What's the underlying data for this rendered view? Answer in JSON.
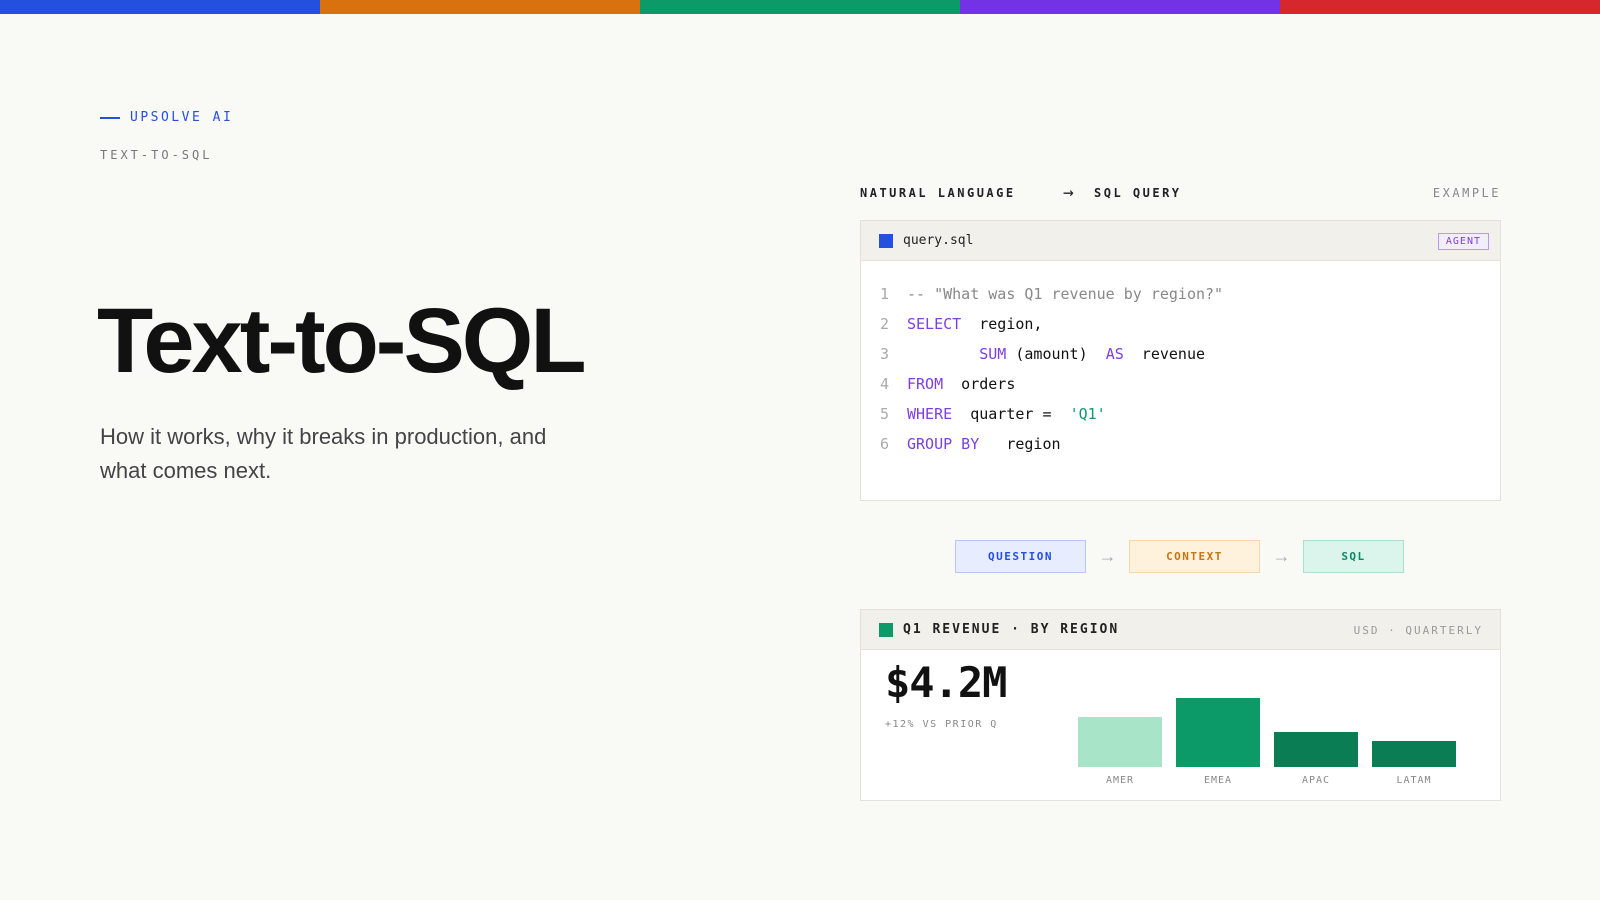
{
  "topbar_colors": [
    "#2450e0",
    "#d9720e",
    "#0d9a69",
    "#7432e6",
    "#d6272e"
  ],
  "brand": {
    "label": "UPSOLVE AI",
    "color": "#2450e0"
  },
  "eyebrow": "TEXT-TO-SQL",
  "title": "Text-to-SQL",
  "subtitle": "How it works, why it breaks in production, and what comes next.",
  "flow": {
    "left": "NATURAL LANGUAGE",
    "arrow": "→",
    "right": "SQL QUERY",
    "tag": "EXAMPLE"
  },
  "code_card": {
    "filename": "query.sql",
    "icon": "square-icon",
    "icon_color": "#2450e0",
    "badge": "AGENT",
    "lines": [
      [
        {
          "t": "-- ",
          "c": "cm"
        },
        {
          "t": "\"What was Q1 revenue by region?\"",
          "c": "cm"
        }
      ],
      [
        {
          "t": "SELECT",
          "c": "kw"
        },
        {
          "t": "  region,",
          "c": "id"
        }
      ],
      [
        {
          "t": "        ",
          "c": "id"
        },
        {
          "t": "SUM",
          "c": "kw"
        },
        {
          "t": " (amount)  ",
          "c": "id"
        },
        {
          "t": "AS",
          "c": "kw"
        },
        {
          "t": "  revenue",
          "c": "id"
        }
      ],
      [
        {
          "t": "FROM",
          "c": "kw"
        },
        {
          "t": "  orders",
          "c": "id"
        }
      ],
      [
        {
          "t": "WHERE",
          "c": "kw"
        },
        {
          "t": "  quarter =  ",
          "c": "id"
        },
        {
          "t": "'Q1'",
          "c": "st"
        }
      ],
      [
        {
          "t": "GROUP BY",
          "c": "kw"
        },
        {
          "t": "   region",
          "c": "id"
        }
      ]
    ]
  },
  "pipeline": {
    "steps": [
      "QUESTION",
      "CONTEXT",
      "SQL"
    ],
    "arrow": "→"
  },
  "revenue_card": {
    "title": "Q1 REVENUE · BY REGION",
    "meta": "USD · QUARTERLY",
    "icon_color": "#0d9a69",
    "total": "$4.2M",
    "delta": "+12% VS PRIOR Q",
    "ylim": [
      0,
      100
    ],
    "bars": [
      {
        "label": "AMER",
        "value": 73,
        "color": "#a8e4c8"
      },
      {
        "label": "EMEA",
        "value": 100,
        "color": "#0d9a69"
      },
      {
        "label": "APAC",
        "value": 51,
        "color": "#0a7d55"
      },
      {
        "label": "LATAM",
        "value": 37,
        "color": "#0a7d55"
      }
    ]
  }
}
